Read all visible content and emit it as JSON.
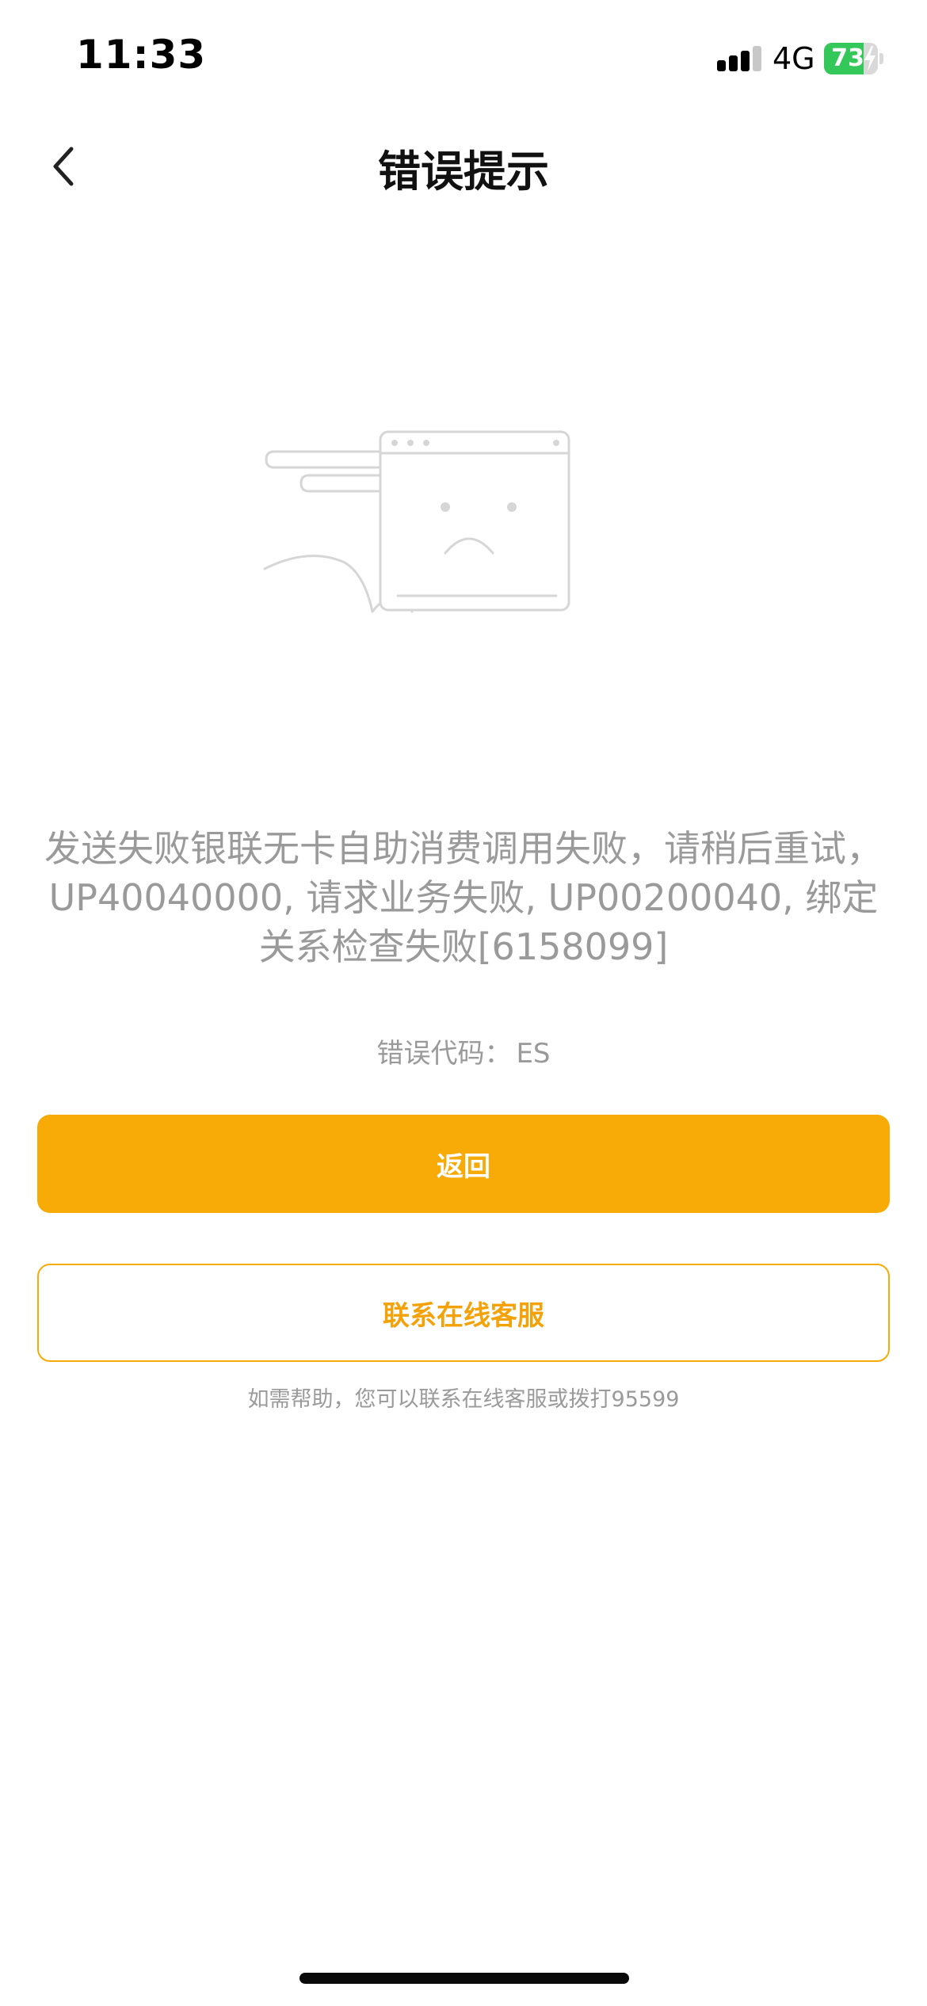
{
  "status_bar": {
    "time": "11:33",
    "network": "4G",
    "battery_level": 73,
    "battery_label": "73",
    "battery_color": "#34c759",
    "signal_icon": "cellular-signal-icon",
    "charging_icon": "lightning-bolt-icon"
  },
  "nav": {
    "back_icon": "chevron-left-icon",
    "title": "错误提示"
  },
  "illustration": {
    "icon": "sad-browser-window-illustration"
  },
  "error": {
    "message": "发送失败银联无卡自助消费调用失败，请稍后重试，UP40040000, 请求业务失败, UP00200040, 绑定关系检查失败[6158099]",
    "code_label": "错误代码：",
    "code_value": "ES"
  },
  "actions": {
    "back_label": "返回",
    "contact_label": "联系在线客服"
  },
  "help_text": "如需帮助，您可以联系在线客服或拨打95599",
  "colors": {
    "accent": "#f8ab07",
    "muted_text": "#9a9a9a",
    "illustration_stroke": "#d6d6d6"
  }
}
